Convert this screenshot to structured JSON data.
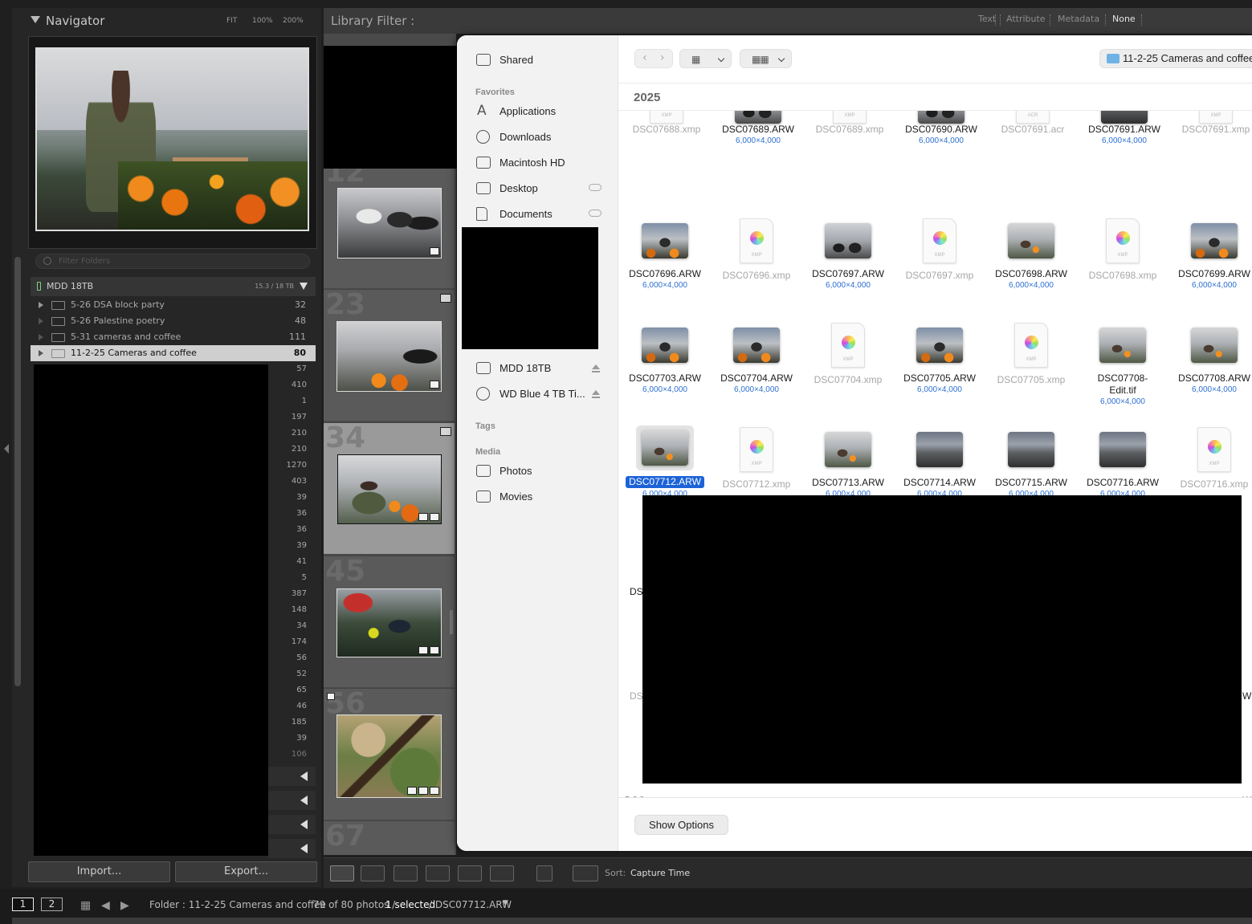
{
  "navigator": {
    "title": "Navigator",
    "zoom_fit": "FIT",
    "zoom_100": "100%",
    "zoom_200": "200%"
  },
  "folders": {
    "filter_placeholder": "Filter Folders",
    "volume_name": "MDD 18TB",
    "volume_size": "15.3 / 18 TB",
    "items": [
      {
        "name": "5-26 DSA block party",
        "count": "32"
      },
      {
        "name": "5-26 Palestine poetry",
        "count": "48"
      },
      {
        "name": "5-31 cameras and coffee",
        "count": "111"
      },
      {
        "name": "11-2-25 Cameras and coffee",
        "count": "80"
      }
    ],
    "more_counts": [
      "57",
      "410",
      "1",
      "197",
      "210",
      "210",
      "1270",
      "403",
      "39",
      "36",
      "36",
      "39",
      "41",
      "5",
      "387",
      "148",
      "34",
      "174",
      "56",
      "52",
      "65",
      "46",
      "185",
      "39",
      "106"
    ]
  },
  "buttons": {
    "import": "Import...",
    "export": "Export..."
  },
  "filterbar": {
    "label": "Library Filter :",
    "text": "Text",
    "attribute": "Attribute",
    "metadata": "Metadata",
    "none": "None"
  },
  "grid": {
    "cell_numbers": [
      "12",
      "23",
      "34",
      "45",
      "56",
      "67"
    ]
  },
  "toolbar": {
    "sort_label": "Sort:",
    "sort_value": "Capture Time"
  },
  "status": {
    "view1": "1",
    "view2": "2",
    "folder": "Folder : 11-2-25 Cameras and coffee",
    "count": "79 of 80 photos /",
    "selected": "1 selected",
    "file": "/ DSC07712.ARW"
  },
  "finder": {
    "sidebar": {
      "shared": "Shared",
      "favorites_header": "Favorites",
      "favorites": [
        "Applications",
        "Downloads",
        "Macintosh HD",
        "Desktop",
        "Documents"
      ],
      "locations": [
        "MDD 18TB",
        "WD Blue 4 TB Ti..."
      ],
      "tags_header": "Tags",
      "media_header": "Media",
      "media": [
        "Photos",
        "Movies"
      ]
    },
    "path": "11-2-25 Cameras and coffee",
    "year": "2025",
    "show_options": "Show Options",
    "files": [
      {
        "name": "DSC07688.xmp",
        "sub": ""
      },
      {
        "name": "DSC07689.ARW",
        "sub": "6,000×4,000"
      },
      {
        "name": "DSC07689.xmp",
        "sub": ""
      },
      {
        "name": "DSC07690.ARW",
        "sub": "6,000×4,000"
      },
      {
        "name": "DSC07691.acr",
        "sub": ""
      },
      {
        "name": "DSC07691.ARW",
        "sub": "6,000×4,000"
      },
      {
        "name": "DSC07691.xmp",
        "sub": ""
      },
      {
        "name": "DSC07696.ARW",
        "sub": "6,000×4,000"
      },
      {
        "name": "DSC07696.xmp",
        "sub": ""
      },
      {
        "name": "DSC07697.ARW",
        "sub": "6,000×4,000"
      },
      {
        "name": "DSC07697.xmp",
        "sub": ""
      },
      {
        "name": "DSC07698.ARW",
        "sub": "6,000×4,000"
      },
      {
        "name": "DSC07698.xmp",
        "sub": ""
      },
      {
        "name": "DSC07699.ARW",
        "sub": "6,000×4,000"
      },
      {
        "name": "DSC07703.ARW",
        "sub": "6,000×4,000"
      },
      {
        "name": "DSC07704.ARW",
        "sub": "6,000×4,000"
      },
      {
        "name": "DSC07704.xmp",
        "sub": ""
      },
      {
        "name": "DSC07705.ARW",
        "sub": "6,000×4,000"
      },
      {
        "name": "DSC07705.xmp",
        "sub": ""
      },
      {
        "name": "DSC07708-Edit.tif",
        "sub": "6,000×4,000"
      },
      {
        "name": "DSC07708.ARW",
        "sub": "6,000×4,000"
      },
      {
        "name": "DSC07712.ARW",
        "sub": "6,000×4,000"
      },
      {
        "name": "DSC07712.xmp",
        "sub": ""
      },
      {
        "name": "DSC07713.ARW",
        "sub": "6,000×4,000"
      },
      {
        "name": "DSC07714.ARW",
        "sub": "6,000×4,000"
      },
      {
        "name": "DSC07715.ARW",
        "sub": "6,000×4,000"
      },
      {
        "name": "DSC07716.ARW",
        "sub": "6,000×4,000"
      },
      {
        "name": "DSC07716.xmp",
        "sub": ""
      }
    ],
    "xmp_badge": "XMP",
    "acr_badge": "ACR",
    "partial": {
      "ds": "DS",
      "dsc": "DSC",
      "w": "W"
    }
  }
}
